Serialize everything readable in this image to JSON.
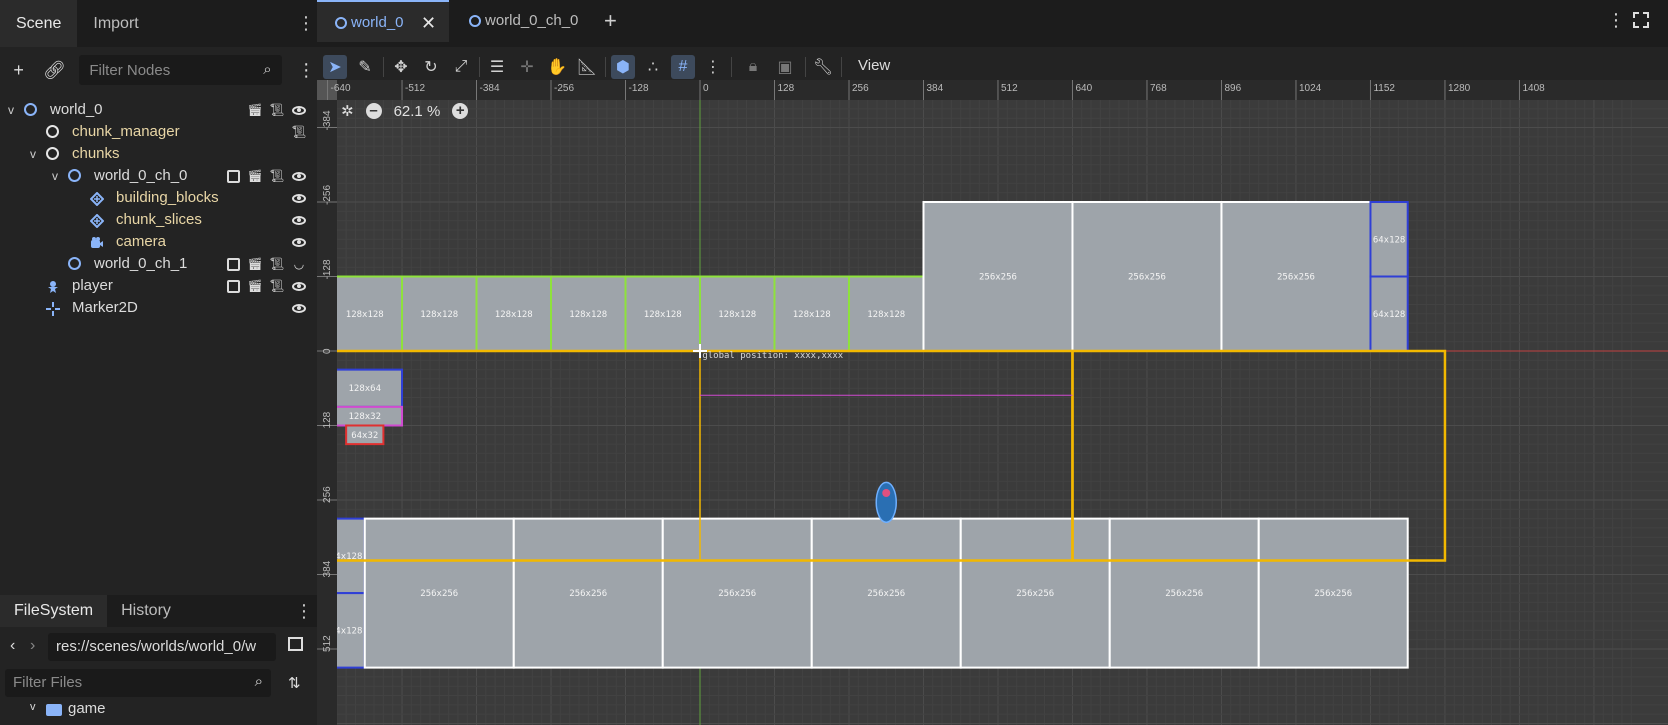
{
  "left_dock": {
    "tabs": [
      "Scene",
      "Import"
    ],
    "filter_nodes_placeholder": "Filter Nodes",
    "tree": [
      {
        "label": "world_0",
        "icon": "node2d-icon",
        "color": "#dcdcdc",
        "depth": 0,
        "arrow": "v"
      },
      {
        "label": "chunk_manager",
        "icon": "node-icon",
        "color": "#e8d6a6",
        "depth": 1,
        "arrow": ""
      },
      {
        "label": "chunks",
        "icon": "node-icon",
        "color": "#e8d6a6",
        "depth": 1,
        "arrow": "v"
      },
      {
        "label": "world_0_ch_0",
        "icon": "node2d-icon",
        "color": "#dcdcdc",
        "depth": 2,
        "arrow": "v"
      },
      {
        "label": "building_blocks",
        "icon": "tilemap-icon",
        "color": "#e8d6a6",
        "depth": 3,
        "arrow": ""
      },
      {
        "label": "chunk_slices",
        "icon": "tilemap-icon",
        "color": "#e8d6a6",
        "depth": 3,
        "arrow": ""
      },
      {
        "label": "camera",
        "icon": "camera-icon",
        "color": "#e8d6a6",
        "depth": 3,
        "arrow": ""
      },
      {
        "label": "world_0_ch_1",
        "icon": "node2d-icon",
        "color": "#dcdcdc",
        "depth": 2,
        "arrow": ""
      },
      {
        "label": "player",
        "icon": "character-icon",
        "color": "#dcdcdc",
        "depth": 1,
        "arrow": ""
      },
      {
        "label": "Marker2D",
        "icon": "marker-icon",
        "color": "#dcdcdc",
        "depth": 1,
        "arrow": ""
      }
    ]
  },
  "filesystem": {
    "tabs": [
      "FileSystem",
      "History"
    ],
    "path": "res://scenes/worlds/world_0/w",
    "filter_files_placeholder": "Filter Files",
    "folder": "game"
  },
  "editor": {
    "tabs": [
      "world_0",
      "world_0_ch_0"
    ],
    "view_label": "View",
    "zoom": "62.1 %",
    "ruler_ticks_x": [
      "-640",
      "-512",
      "-384",
      "-256",
      "-128",
      "0",
      "128",
      "256",
      "384",
      "512",
      "640",
      "768",
      "896",
      "1024",
      "1152",
      "1280",
      "1408"
    ],
    "ruler_ticks_y": [
      "-384",
      "-256",
      "-128",
      "0",
      "128",
      "256",
      "384",
      "512"
    ],
    "block_labels": {
      "b128": "128x128",
      "b256": "256x256",
      "b64x128": "64x128",
      "b128x64": "128x64",
      "b128x32": "128x32",
      "b64x32": "64x32",
      "global_pos": "global position: xxxx,xxxx"
    }
  },
  "colors": {
    "accent": "#8ab4f8",
    "green_outline": "#8ee23c",
    "yellow_outline": "#f2b800",
    "blue_outline": "#2f3fd6",
    "red_outline": "#e03030",
    "magenta": "#d04ad0",
    "block_fill": "#9ea4aa"
  }
}
